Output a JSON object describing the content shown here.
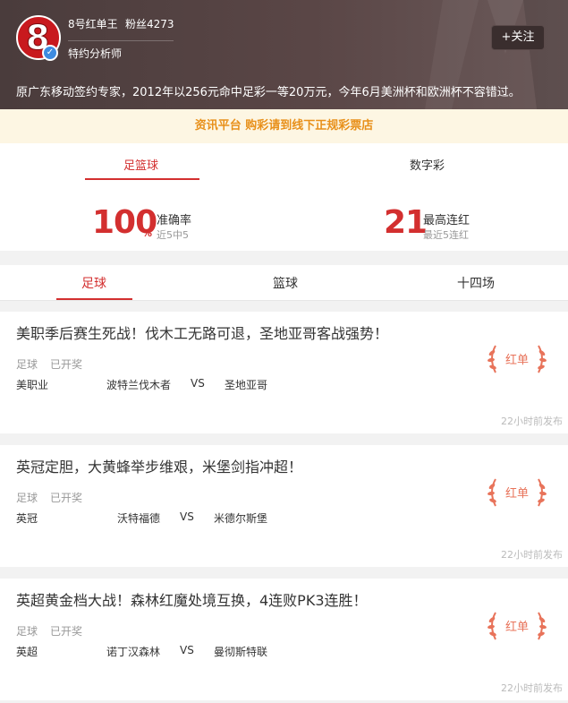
{
  "profile": {
    "avatar_text": "8",
    "name": "8号红单王",
    "fans": "粉丝4273",
    "role": "特约分析师",
    "follow_label": "+关注",
    "bio": "原广东移动签约专家，2012年以256元命中足彩一等20万元，今年6月美洲杯和欧洲杯不容错过。"
  },
  "notice": "资讯平台 购彩请到线下正规彩票店",
  "category_tabs": [
    {
      "label": "足篮球",
      "active": true
    },
    {
      "label": "数字彩",
      "active": false
    }
  ],
  "stats": {
    "accuracy_value": "100",
    "accuracy_unit": "%",
    "accuracy_label": "准确率",
    "accuracy_sub": "近5中5",
    "streak_value": "21",
    "streak_label": "最高连红",
    "streak_sub": "最近5连红"
  },
  "sub_tabs": [
    {
      "label": "足球",
      "active": true
    },
    {
      "label": "篮球",
      "active": false
    },
    {
      "label": "十四场",
      "active": false
    }
  ],
  "cards": [
    {
      "title": "美职季后赛生死战！伐木工无路可退，圣地亚哥客战强势！",
      "sport": "足球",
      "status": "已开奖",
      "league": "美职业",
      "home": "波特兰伐木者",
      "vs": "VS",
      "away": "圣地亚哥",
      "badge": "红单",
      "published": "22小时前发布"
    },
    {
      "title": "英冠定胆，大黄蜂举步维艰，米堡剑指冲超！",
      "sport": "足球",
      "status": "已开奖",
      "league": "英冠",
      "home": "沃特福德",
      "vs": "VS",
      "away": "米德尔斯堡",
      "badge": "红单",
      "published": "22小时前发布"
    },
    {
      "title": "英超黄金档大战！森林红魔处境互换，4连败PK3连胜！",
      "sport": "足球",
      "status": "已开奖",
      "league": "英超",
      "home": "诺丁汉森林",
      "vs": "VS",
      "away": "曼彻斯特联",
      "badge": "红单",
      "published": "22小时前发布"
    }
  ],
  "colors": {
    "accent": "#d32f2f",
    "header_bg": "#4a3c3c",
    "notice_text": "#e8901a",
    "stamp": "#e8735a"
  }
}
